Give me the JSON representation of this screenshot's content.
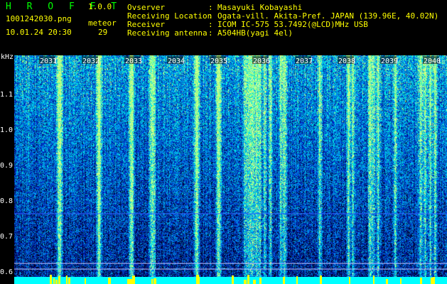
{
  "app": {
    "name": "H R O F F T",
    "version": "1.0.0"
  },
  "file": {
    "name": "1001242030.png",
    "datetime": "10.01.24 20:30"
  },
  "meteor": {
    "label": "meteor",
    "count": "29"
  },
  "info": [
    {
      "label": "Ovserver",
      "sep": ":",
      "value": "Masayuki Kobayashi"
    },
    {
      "label": "Receiving Location",
      "sep": ":",
      "value": "Ogata-vill. Akita-Pref. JAPAN (139.96E, 40.02N)"
    },
    {
      "label": "Receiver",
      "sep": ":",
      "value": "ICOM IC-575 53.7492(@LCD)MHz USB"
    },
    {
      "label": "Receiving antenna",
      "sep": ":",
      "value": "A504HB(yagi 4el)"
    }
  ],
  "y_axis": {
    "unit": "kHz",
    "ticks": [
      "1.1",
      "1.0",
      "0.9",
      "0.8",
      "0.7",
      "0.6"
    ]
  },
  "x_axis": {
    "ticks": [
      "2031",
      "2032",
      "2033",
      "2034",
      "2035",
      "2036",
      "2037",
      "2038",
      "2039",
      "2040"
    ]
  },
  "colors": {
    "background": "#000000",
    "spectrogram_low": "#000060",
    "spectrogram_mid": "#0050ff",
    "spectrogram_high": "#00ffff",
    "meteor_echo": "#ffff00",
    "label_text": "#ffff00",
    "logo_text": "#00ff00",
    "axis_text": "#ffffff"
  }
}
